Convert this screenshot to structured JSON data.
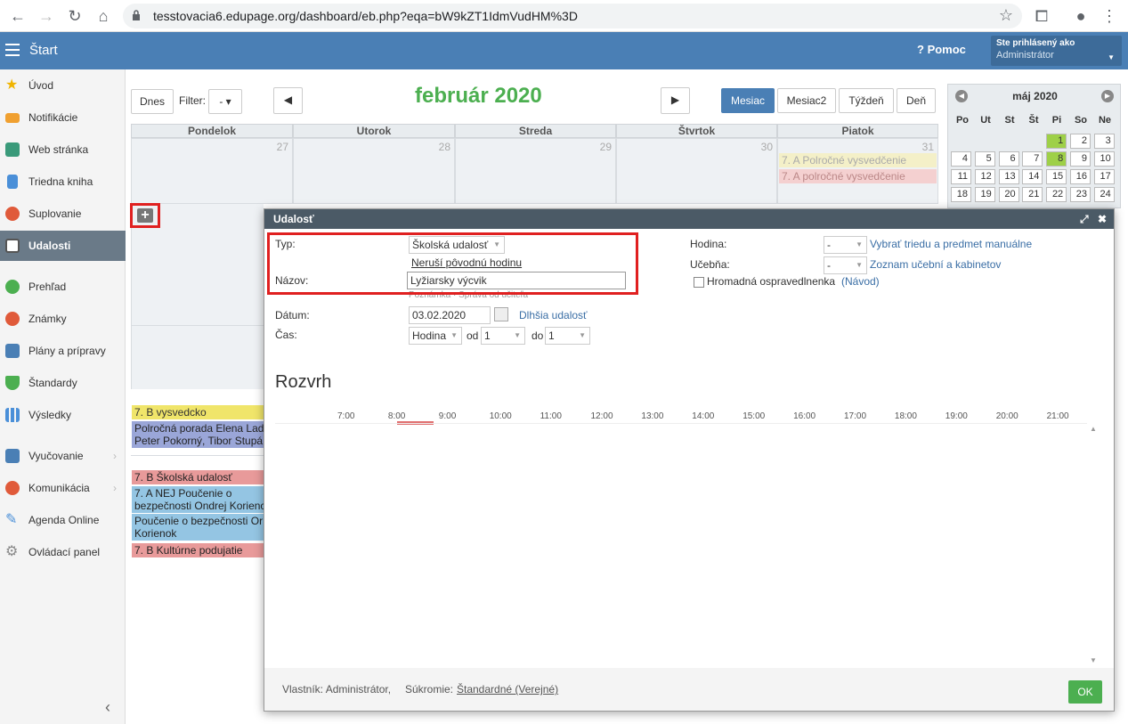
{
  "browser": {
    "url": "tesstovacia6.edupage.org/dashboard/eb.php?eqa=bW9kZT1IdmVudHM%3D"
  },
  "header": {
    "start_label": "Štart",
    "help_label": "Pomoc",
    "user_line1": "Ste prihlásený ako",
    "user_line2": "Administrátor"
  },
  "sidebar": {
    "items": [
      {
        "label": "Úvod",
        "icon": "star-icon",
        "color": "#f0b400"
      },
      {
        "label": "Notifikácie",
        "icon": "envelope-icon",
        "color": "#f0a030"
      },
      {
        "label": "Web stránka",
        "icon": "house-icon",
        "color": "#3a9a7a"
      },
      {
        "label": "Triedna kniha",
        "icon": "book-icon",
        "color": "#4a8fd8"
      },
      {
        "label": "Suplovanie",
        "icon": "person-icon",
        "color": "#e05a3a"
      },
      {
        "label": "Udalosti",
        "icon": "calendar-icon",
        "color": "#ffffff"
      },
      {
        "label": "Prehľad",
        "icon": "check-icon",
        "color": "#4caf50"
      },
      {
        "label": "Známky",
        "icon": "grade-icon",
        "color": "#e05a3a"
      },
      {
        "label": "Plány a prípravy",
        "icon": "briefcase-icon",
        "color": "#4a7fb5"
      },
      {
        "label": "Štandardy",
        "icon": "shield-icon",
        "color": "#4caf50"
      },
      {
        "label": "Výsledky",
        "icon": "chart-icon",
        "color": "#4a8fd8"
      },
      {
        "label": "Vyučovanie",
        "icon": "open-book-icon",
        "color": "#4a7fb5"
      },
      {
        "label": "Komunikácia",
        "icon": "chat-icon",
        "color": "#e05a3a"
      },
      {
        "label": "Agenda Online",
        "icon": "pen-icon",
        "color": "#4a8fd8"
      },
      {
        "label": "Ovládací panel",
        "icon": "gear-icon",
        "color": "#888888"
      }
    ]
  },
  "toolbar": {
    "today": "Dnes",
    "filter": "Filter:",
    "filter_value": "- ▾",
    "month_title": "február 2020",
    "views": [
      "Mesiac",
      "Mesiac2",
      "Týždeň",
      "Deň"
    ]
  },
  "calendar": {
    "days": [
      "Pondelok",
      "Utorok",
      "Streda",
      "Štvrtok",
      "Piatok"
    ],
    "first_row": [
      "27",
      "28",
      "29",
      "30",
      "31"
    ],
    "friday_events": [
      "7. A Polročné vysvedčenie",
      "7. A polročné vysvedčenie"
    ],
    "lower_events": [
      {
        "text": "7. B vysvedcko",
        "style": "yellow"
      },
      {
        "text": "Polročná porada Elena Lad",
        "style": "purple"
      },
      {
        "text": "Peter Pokorný, Tibor Stupá",
        "style": "purple"
      },
      {
        "text": "7. B Školská udalosť",
        "style": "red"
      },
      {
        "text": "7. A NEJ Poučenie o",
        "style": "blue"
      },
      {
        "text": "bezpečnosti Ondrej Korienc",
        "style": "blue"
      },
      {
        "text": "Poučenie o bezpečnosti Or",
        "style": "blue"
      },
      {
        "text": "Korienok",
        "style": "blue"
      },
      {
        "text": "7. B Kultúrne podujatie",
        "style": "red"
      }
    ]
  },
  "mini_cal": {
    "title": "máj 2020",
    "dow": [
      "Po",
      "Ut",
      "St",
      "Št",
      "Pi",
      "So",
      "Ne"
    ],
    "rows": [
      [
        "",
        "",
        "",
        "",
        "1",
        "2",
        "3"
      ],
      [
        "4",
        "5",
        "6",
        "7",
        "8",
        "9",
        "10"
      ],
      [
        "11",
        "12",
        "13",
        "14",
        "15",
        "16",
        "17"
      ],
      [
        "18",
        "19",
        "20",
        "21",
        "22",
        "23",
        "24"
      ]
    ]
  },
  "modal": {
    "title": "Udalosť",
    "typ_label": "Typ:",
    "typ_value": "Školská udalosť",
    "no_override": "Neruší pôvodnú hodinu",
    "nazov_label": "Názov:",
    "nazov_value": "Lyžiarsky výcvik",
    "hint": "Poznámka · Správa od učiteľa",
    "datum_label": "Dátum:",
    "datum_value": "03.02.2020",
    "longer_event": "Dlhšia udalosť",
    "cas_label": "Čas:",
    "cas_mode": "Hodina",
    "od_label": "od",
    "od_value": "1",
    "do_label": "do",
    "do_value": "1",
    "hodina_label": "Hodina:",
    "hodina_value": "-",
    "hodina_link": "Vybrať triedu a predmet manuálne",
    "ucebna_label": "Učebňa:",
    "ucebna_value": "-",
    "ucebna_link": "Zoznam učební a kabinetov",
    "excuse_label": "Hromadná ospravedlnenka",
    "excuse_link": "(Návod)",
    "rozvrh_title": "Rozvrh",
    "hours": [
      "7:00",
      "8:00",
      "9:00",
      "10:00",
      "11:00",
      "12:00",
      "13:00",
      "14:00",
      "15:00",
      "16:00",
      "17:00",
      "18:00",
      "19:00",
      "20:00",
      "21:00"
    ],
    "owner": "Vlastník: Administrátor,",
    "privacy_label": "Súkromie:",
    "privacy_value": "Štandardné (Verejné)",
    "ok": "OK"
  }
}
